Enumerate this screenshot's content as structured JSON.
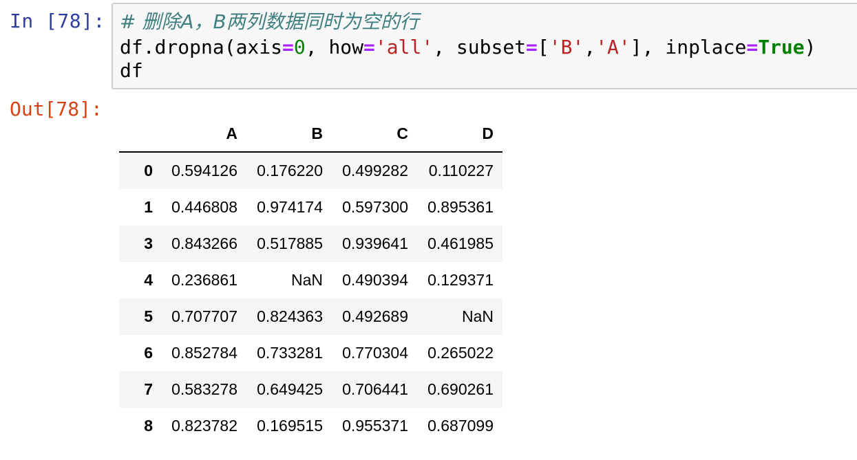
{
  "input_cell": {
    "prompt": "In [78]:",
    "comment": "# 删除A，B两列数据同时为空的行",
    "line2": {
      "pre": "df.dropna(axis",
      "eq1": "=",
      "num": "0",
      "mid1": ", how",
      "eq2": "=",
      "str1": "'all'",
      "mid2": ", subset",
      "eq3": "=",
      "lb": "[",
      "str2": "'B'",
      "comma": ",",
      "str3": "'A'",
      "rb": "], inplace",
      "eq4": "=",
      "kw": "True",
      "end": ")"
    },
    "line3": "df"
  },
  "output_cell": {
    "prompt": "Out[78]:",
    "table": {
      "columns": [
        "",
        "A",
        "B",
        "C",
        "D"
      ],
      "rows": [
        {
          "index": "0",
          "values": [
            "0.594126",
            "0.176220",
            "0.499282",
            "0.110227"
          ]
        },
        {
          "index": "1",
          "values": [
            "0.446808",
            "0.974174",
            "0.597300",
            "0.895361"
          ]
        },
        {
          "index": "3",
          "values": [
            "0.843266",
            "0.517885",
            "0.939641",
            "0.461985"
          ]
        },
        {
          "index": "4",
          "values": [
            "0.236861",
            "NaN",
            "0.490394",
            "0.129371"
          ]
        },
        {
          "index": "5",
          "values": [
            "0.707707",
            "0.824363",
            "0.492689",
            "NaN"
          ]
        },
        {
          "index": "6",
          "values": [
            "0.852784",
            "0.733281",
            "0.770304",
            "0.265022"
          ]
        },
        {
          "index": "7",
          "values": [
            "0.583278",
            "0.649425",
            "0.706441",
            "0.690261"
          ]
        },
        {
          "index": "8",
          "values": [
            "0.823782",
            "0.169515",
            "0.955371",
            "0.687099"
          ]
        }
      ]
    }
  },
  "colors": {
    "in_prompt": "#303f9f",
    "out_prompt": "#d84315",
    "comment": "#408080",
    "operator": "#aa22ff",
    "number": "#008000",
    "string": "#ba2121",
    "keyword": "#008000",
    "code_bg": "#f7f7f7",
    "stripe_bg": "#f5f5f5"
  }
}
